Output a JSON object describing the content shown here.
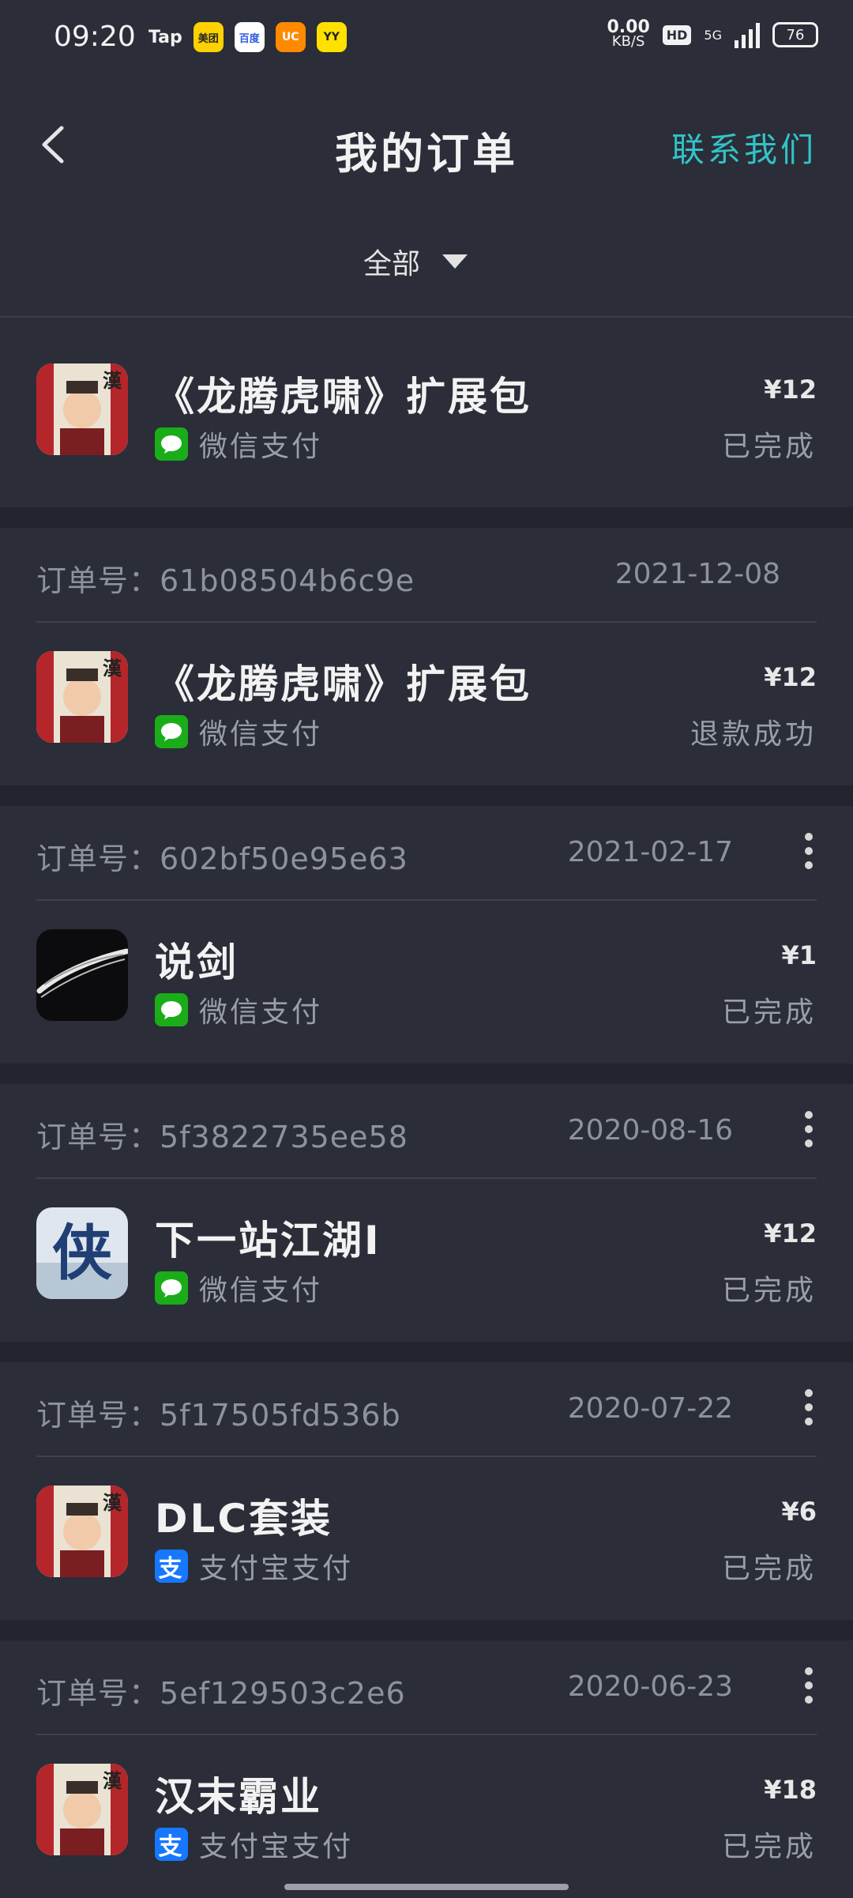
{
  "status_bar": {
    "time": "09:20",
    "apps": [
      "Tap",
      "美团",
      "百度",
      "UC",
      "YY"
    ],
    "net_speed": "0.00",
    "net_unit": "KB/S",
    "hd": "HD",
    "network": "5G",
    "battery": "76"
  },
  "header": {
    "title": "我的订单",
    "contact_label": "联系我们",
    "filter_label": "全部"
  },
  "orders": [
    {
      "order_no": "",
      "date": "",
      "name": "《龙腾虎啸》扩展包",
      "payment": "微信支付",
      "payment_type": "wechat",
      "price": "¥12",
      "status": "已完成",
      "thumb": "han-warrior",
      "has_more": false
    },
    {
      "order_no": "订单号：61b08504b6c9e",
      "date": "2021-12-08",
      "name": "《龙腾虎啸》扩展包",
      "payment": "微信支付",
      "payment_type": "wechat",
      "price": "¥12",
      "status": "退款成功",
      "thumb": "han-warrior",
      "has_more": false
    },
    {
      "order_no": "订单号：602bf50e95e63",
      "date": "2021-02-17",
      "name": "说剑",
      "payment": "微信支付",
      "payment_type": "wechat",
      "price": "¥1",
      "status": "已完成",
      "thumb": "sword-stroke",
      "has_more": true
    },
    {
      "order_no": "订单号：5f3822735ee58",
      "date": "2020-08-16",
      "name": "下一站江湖Ⅰ",
      "payment": "微信支付",
      "payment_type": "wechat",
      "price": "¥12",
      "status": "已完成",
      "thumb": "xia-calligraphy",
      "has_more": true
    },
    {
      "order_no": "订单号：5f17505fd536b",
      "date": "2020-07-22",
      "name": "DLC套装",
      "payment": "支付宝支付",
      "payment_type": "alipay",
      "price": "¥6",
      "status": "已完成",
      "thumb": "han-warrior",
      "has_more": true
    },
    {
      "order_no": "订单号：5ef129503c2e6",
      "date": "2020-06-23",
      "name": "汉末霸业",
      "payment": "支付宝支付",
      "payment_type": "alipay",
      "price": "¥18",
      "status": "已完成",
      "thumb": "han-warrior",
      "has_more": true
    }
  ],
  "colors": {
    "background": "#22242e",
    "card": "#2b2d38",
    "accent": "#32c3c7",
    "wechat": "#1aad19",
    "alipay": "#1677ff"
  }
}
